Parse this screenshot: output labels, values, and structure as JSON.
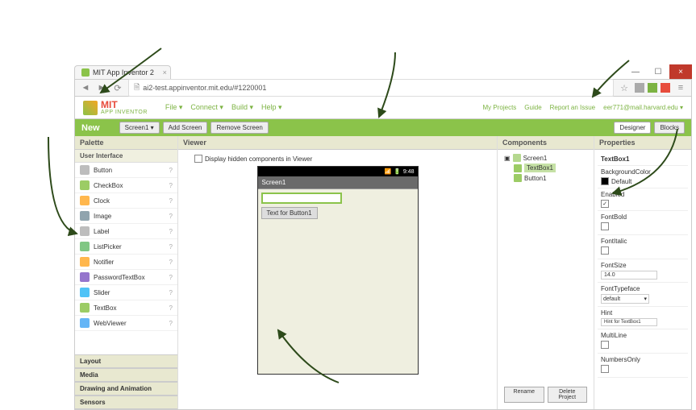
{
  "browser": {
    "tab_title": "MIT App Inventor 2",
    "url": "ai2-test.appinventor.mit.edu/#1220001"
  },
  "header": {
    "logo_main": "MIT",
    "logo_sub": "APP INVENTOR",
    "menu": [
      "File ▾",
      "Connect ▾",
      "Build ▾",
      "Help ▾"
    ],
    "right_links": [
      "My Projects",
      "Guide",
      "Report an Issue"
    ],
    "user": "eer771@mail.harvard.edu ▾"
  },
  "greenbar": {
    "project_name": "New",
    "screen_btn": "Screen1 ▾",
    "add_screen": "Add Screen",
    "remove_screen": "Remove Screen",
    "designer": "Designer",
    "blocks": "Blocks"
  },
  "palette": {
    "title": "Palette",
    "category": "User Interface",
    "items": [
      "Button",
      "CheckBox",
      "Clock",
      "Image",
      "Label",
      "ListPicker",
      "Notifier",
      "PasswordTextBox",
      "Slider",
      "TextBox",
      "WebViewer"
    ],
    "other_cats": [
      "Layout",
      "Media",
      "Drawing and Animation",
      "Sensors"
    ]
  },
  "viewer": {
    "title": "Viewer",
    "display_hidden": "Display hidden components in Viewer",
    "time": "9:48",
    "screen_title": "Screen1",
    "button_text": "Text for Button1"
  },
  "components": {
    "title": "Components",
    "root": "Screen1",
    "children": [
      "TextBox1",
      "Button1"
    ],
    "rename": "Rename",
    "delete": "Delete Project"
  },
  "properties": {
    "title": "Properties",
    "component": "TextBox1",
    "bg_label": "BackgroundColor",
    "bg_val": "Default",
    "enabled_label": "Enabled",
    "enabled_val": true,
    "fontbold_label": "FontBold",
    "fontbold_val": false,
    "fontitalic_label": "FontItalic",
    "fontitalic_val": false,
    "fontsize_label": "FontSize",
    "fontsize_val": "14.0",
    "typeface_label": "FontTypeface",
    "typeface_val": "default",
    "hint_label": "Hint",
    "hint_val": "Hint for TextBox1",
    "multiline_label": "MultiLine",
    "multiline_val": false,
    "numbers_label": "NumbersOnly",
    "numbers_val": false
  }
}
